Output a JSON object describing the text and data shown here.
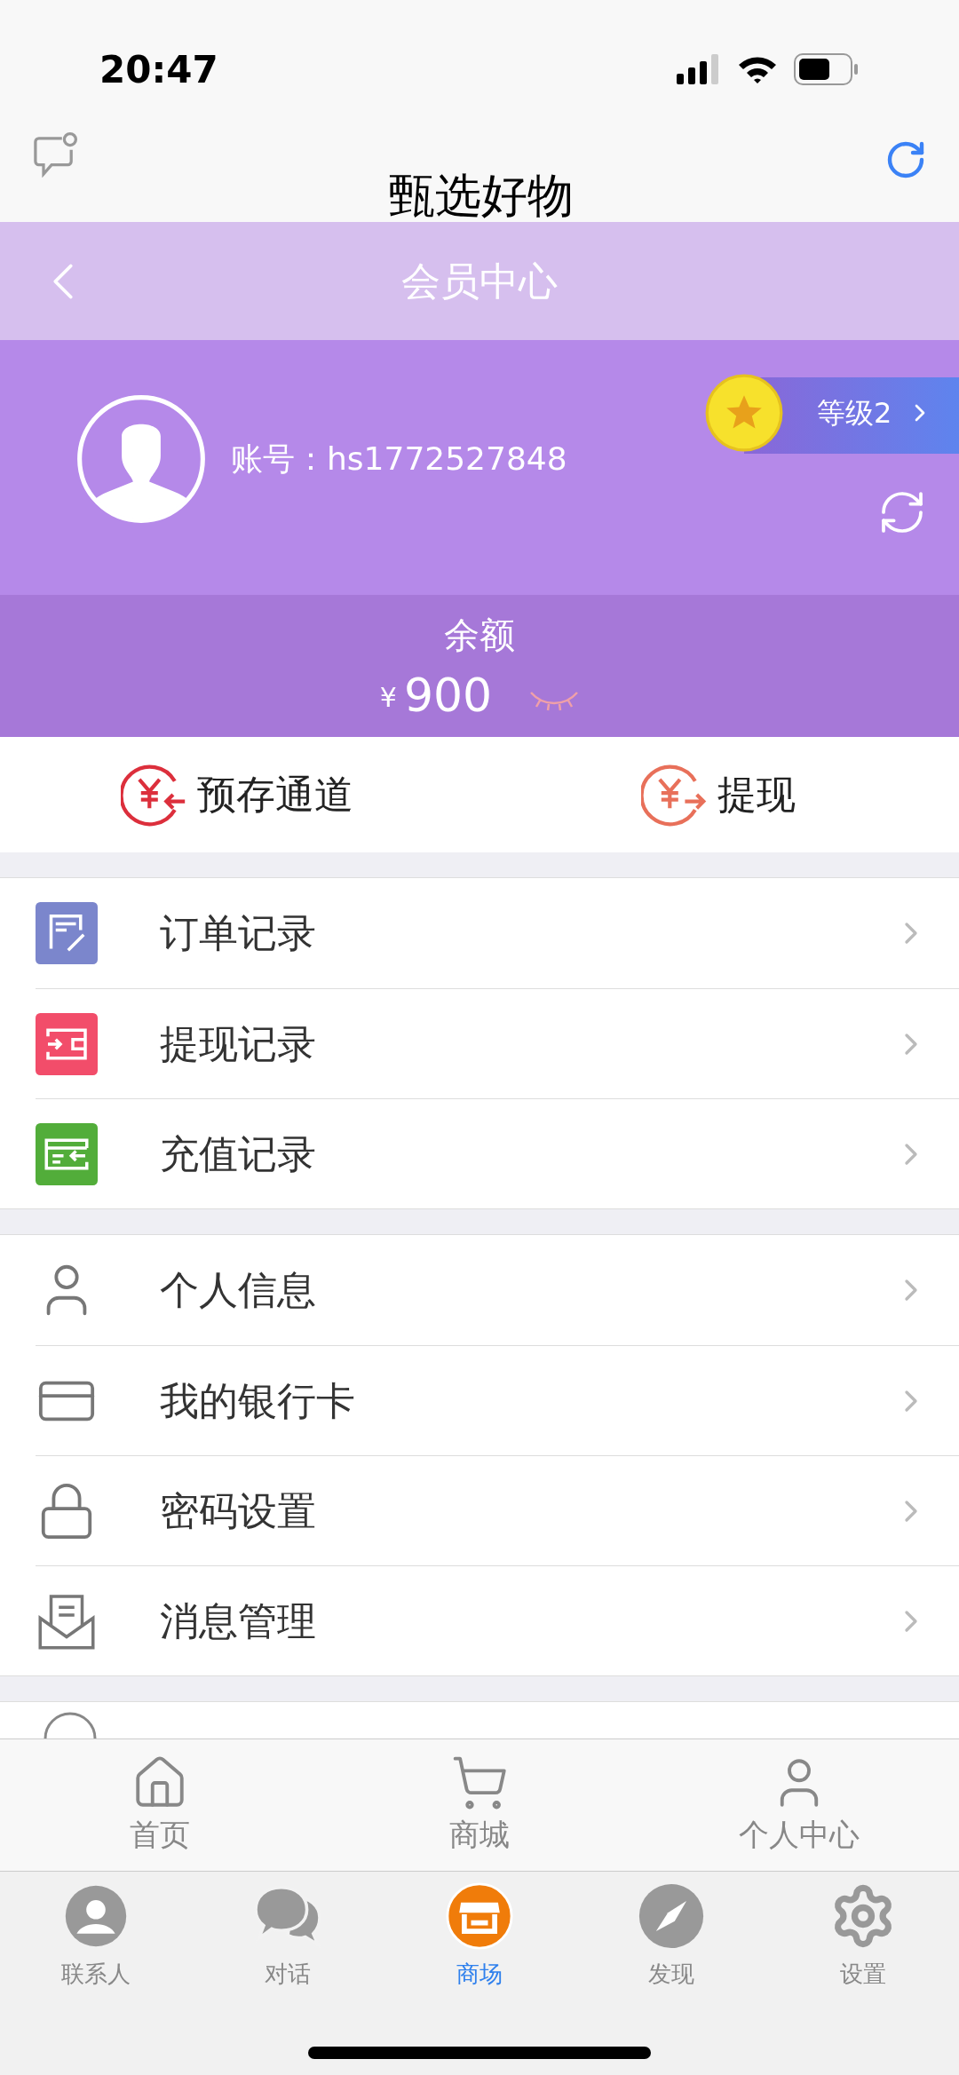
{
  "status_bar": {
    "time": "20:47"
  },
  "app_header": {
    "title": "甄选好物"
  },
  "nav_bar": {
    "title": "会员中心"
  },
  "profile": {
    "account_label": "账号：",
    "account": "hs1772527848",
    "level": "等级2"
  },
  "balance": {
    "label": "余额",
    "currency": "¥",
    "amount": "900"
  },
  "actions": [
    {
      "label": "预存通道",
      "kind": "deposit"
    },
    {
      "label": "提现",
      "kind": "withdraw"
    }
  ],
  "menu_groups": [
    [
      {
        "label": "订单记录",
        "kind": "order",
        "color": "#7b86cc"
      },
      {
        "label": "提现记录",
        "kind": "wallet",
        "color": "#f24d6a"
      },
      {
        "label": "充值记录",
        "kind": "recharge",
        "color": "#52ad3a"
      }
    ],
    [
      {
        "label": "个人信息",
        "kind": "person"
      },
      {
        "label": "我的银行卡",
        "kind": "card"
      },
      {
        "label": "密码设置",
        "kind": "lock"
      },
      {
        "label": "消息管理",
        "kind": "mail"
      }
    ]
  ],
  "page_tabs": [
    {
      "label": "首页",
      "kind": "home",
      "selected": false
    },
    {
      "label": "商城",
      "kind": "cart",
      "selected": false
    },
    {
      "label": "个人中心",
      "kind": "person",
      "selected": false
    }
  ],
  "app_tabs": [
    {
      "label": "联系人",
      "kind": "contacts",
      "selected": false
    },
    {
      "label": "对话",
      "kind": "chat",
      "selected": false
    },
    {
      "label": "商场",
      "kind": "store",
      "selected": true
    },
    {
      "label": "发现",
      "kind": "discover",
      "selected": false
    },
    {
      "label": "设置",
      "kind": "settings",
      "selected": false
    }
  ]
}
